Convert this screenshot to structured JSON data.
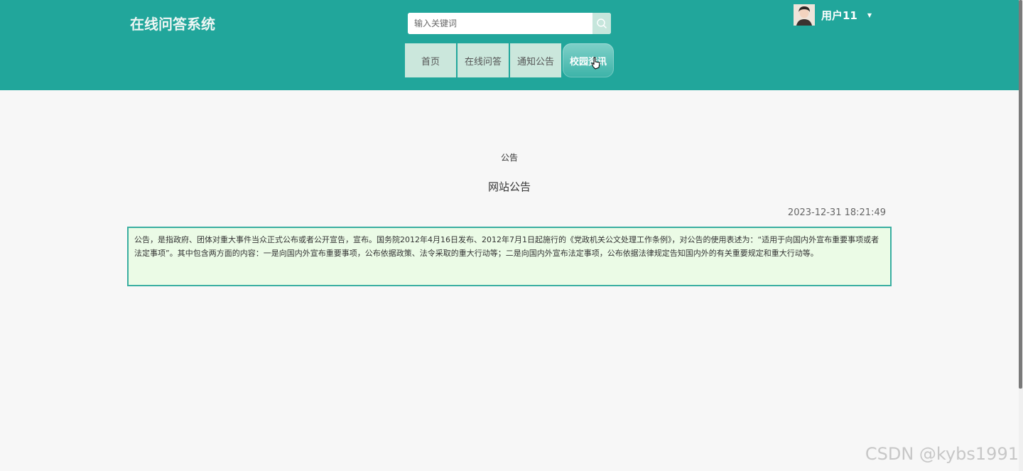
{
  "header": {
    "site_title": "在线问答系统",
    "search": {
      "placeholder": "输入关键词",
      "value": "",
      "icon": "search-icon"
    },
    "nav": [
      {
        "label": "首页",
        "active": false
      },
      {
        "label": "在线问答",
        "active": false
      },
      {
        "label": "通知公告",
        "active": false
      },
      {
        "label": "校园资讯",
        "active": true
      }
    ],
    "user": {
      "name": "用户11",
      "avatar_icon": "avatar-image",
      "caret_icon": "caret-down-icon"
    },
    "colors": {
      "header_bg": "#21a69b",
      "nav_bg": "#cbe7dc",
      "active_nav": "#3cb3a8"
    }
  },
  "main": {
    "category": "公告",
    "title": "网站公告",
    "date": "2023-12-31 18:21:49",
    "content": "公告，是指政府、团体对重大事件当众正式公布或者公开宣告，宣布。国务院2012年4月16日发布、2012年7月1日起施行的《党政机关公文处理工作条例》，对公告的使用表述为：“适用于向国内外宣布重要事项或者法定事项”。其中包含两方面的内容：一是向国内外宣布重要事项，公布依据政策、法令采取的重大行动等；二是向国内外宣布法定事项，公布依据法律规定告知国内外的有关重要规定和重大行动等。",
    "content_box_colors": {
      "bg": "#ebfbe6",
      "border": "#3aaea1"
    }
  },
  "watermark": "CSDN @kybs1991"
}
